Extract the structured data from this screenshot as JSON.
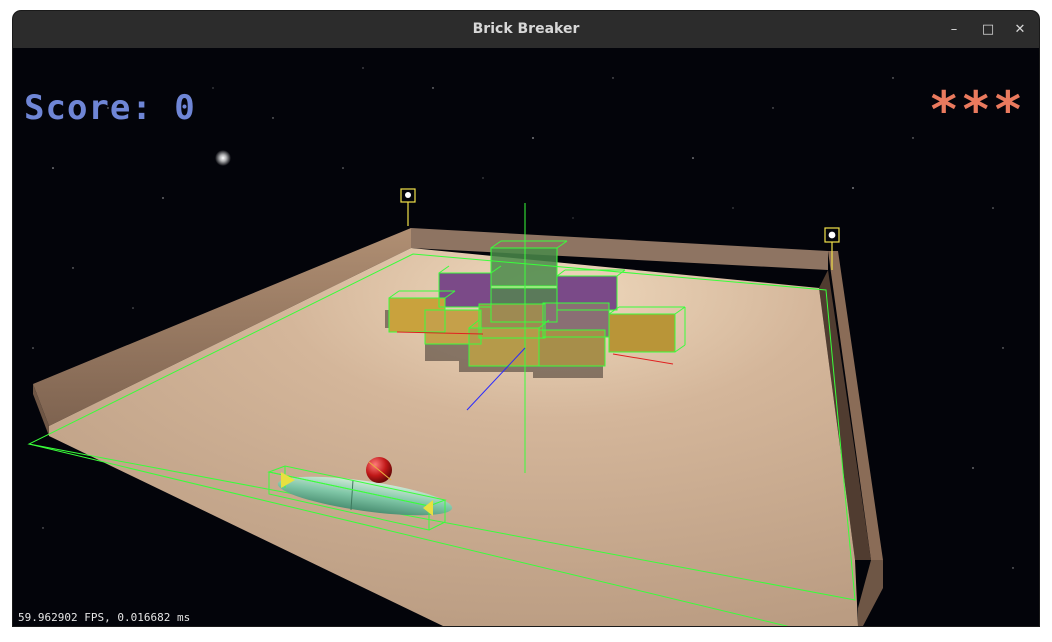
{
  "window": {
    "title": "Brick Breaker",
    "minimize_label": "–",
    "maximize_label": "□",
    "close_label": "✕"
  },
  "hud": {
    "score_text": "Score: 0",
    "lives_text": "***",
    "fps_text": "59.962902 FPS, 0.016682 ms"
  },
  "colors": {
    "score": "#6f86d6",
    "lives": "#ea7a5e",
    "debug_wire": "#39ff3a",
    "floor": "#c2a287",
    "wall": "#9b7e68"
  }
}
